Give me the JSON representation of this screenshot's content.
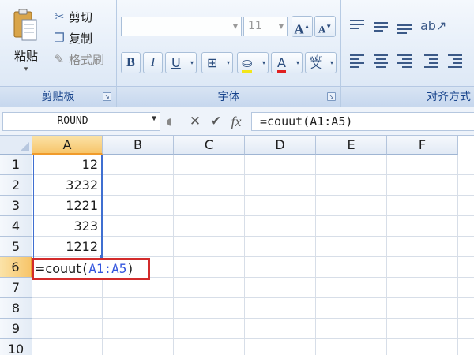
{
  "ribbon": {
    "clipboard": {
      "paste_label": "粘贴",
      "cut_label": "剪切",
      "copy_label": "复制",
      "format_painter_label": "格式刷",
      "group_label": "剪贴板"
    },
    "font": {
      "font_name": "",
      "font_size": "11",
      "grow_label": "A",
      "shrink_label": "A",
      "bold_label": "B",
      "italic_label": "I",
      "underline_label": "U",
      "font_color_label": "A",
      "phonetic_label": "wén",
      "phonetic_char": "文",
      "group_label": "字体"
    },
    "alignment": {
      "group_label": "对齐方式"
    }
  },
  "formula_bar": {
    "name_box": "ROUND",
    "cancel_symbol": "✕",
    "enter_symbol": "✔",
    "fx_label": "fx",
    "formula": "=couut(A1:A5)"
  },
  "grid": {
    "columns": [
      "A",
      "B",
      "C",
      "D",
      "E",
      "F"
    ],
    "rows": [
      "1",
      "2",
      "3",
      "4",
      "5",
      "6",
      "7",
      "8",
      "9",
      "10"
    ],
    "cells": {
      "A1": "12",
      "A2": "3232",
      "A3": "1221",
      "A4": "323",
      "A5": "1212"
    },
    "active_column": "A",
    "active_row": "6",
    "editing": {
      "prefix": "=couut",
      "open_paren": "(",
      "ref": "A1:A5",
      "close_paren": ")"
    }
  },
  "colors": {
    "edit_box_border": "#d22b2b",
    "range_highlight": "#3f6fd1",
    "active_header": "#f7c56a",
    "ribbon_label": "#15428b"
  }
}
